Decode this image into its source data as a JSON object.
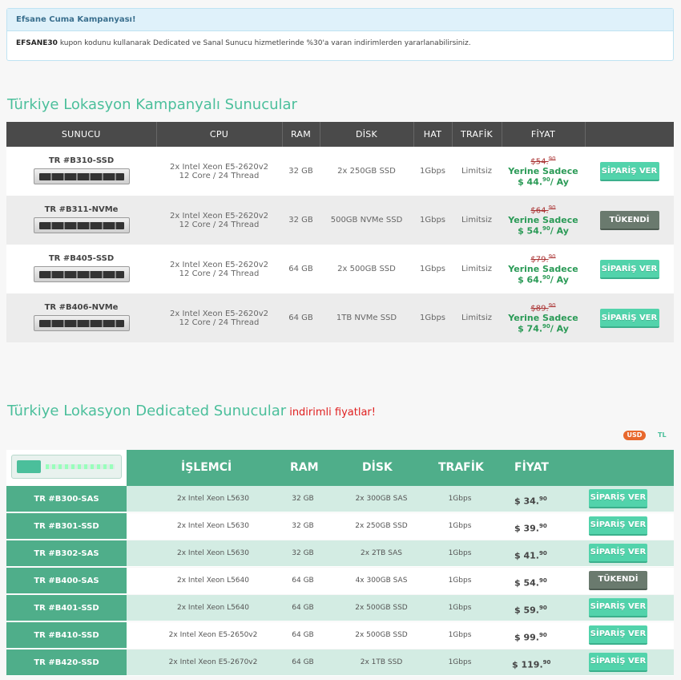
{
  "notice": {
    "title": "Efsane Cuma Kampanyası!",
    "coupon": "EFSANE30",
    "text": " kupon kodunu kullanarak Dedicated ve Sanal Sunucu hizmetlerinde %30'a varan indirimlerden yararlanabilirsiniz."
  },
  "campaign": {
    "title": "Türkiye Lokasyon Kampanyalı Sunucular",
    "headers": [
      "SUNUCU",
      "CPU",
      "RAM",
      "DİSK",
      "HAT",
      "TRAFİK",
      "FİYAT",
      ""
    ],
    "sadece_label": "Yerine Sadece",
    "per_month": "/ Ay",
    "rows": [
      {
        "name": "TR #B310-SSD",
        "cpu1": "2x Intel Xeon E5-2620v2",
        "cpu2": "12 Core / 24 Thread",
        "ram": "32 GB",
        "disk": "2x 250GB SSD",
        "hat": "1Gbps",
        "traffic": "Limitsiz",
        "old_int": "$54.",
        "old_dec": "90",
        "new_int": "$ 44.",
        "new_dec": "90",
        "button": "SİPARİŞ VER"
      },
      {
        "name": "TR #B311-NVMe",
        "cpu1": "2x Intel Xeon E5-2620v2",
        "cpu2": "12 Core / 24 Thread",
        "ram": "32 GB",
        "disk": "500GB NVMe SSD",
        "hat": "1Gbps",
        "traffic": "Limitsiz",
        "old_int": "$64.",
        "old_dec": "90",
        "new_int": "$ 54.",
        "new_dec": "90",
        "button": "TÜKENDİ"
      },
      {
        "name": "TR #B405-SSD",
        "cpu1": "2x Intel Xeon E5-2620v2",
        "cpu2": "12 Core / 24 Thread",
        "ram": "64 GB",
        "disk": "2x 500GB SSD",
        "hat": "1Gbps",
        "traffic": "Limitsiz",
        "old_int": "$79.",
        "old_dec": "90",
        "new_int": "$ 64.",
        "new_dec": "90",
        "button": "SİPARİŞ VER"
      },
      {
        "name": "TR #B406-NVMe",
        "cpu1": "2x Intel Xeon E5-2620v2",
        "cpu2": "12 Core / 24 Thread",
        "ram": "64 GB",
        "disk": "1TB NVMe SSD",
        "hat": "1Gbps",
        "traffic": "Limitsiz",
        "old_int": "$89.",
        "old_dec": "90",
        "new_int": "$ 74.",
        "new_dec": "90",
        "button": "SİPARİŞ VER"
      }
    ]
  },
  "dedicated": {
    "title": "Türkiye Lokasyon Dedicated Sunucular",
    "tag": "indirimli fiyatlar!",
    "currency_usd": "USD",
    "currency_tl": "TL",
    "headers": [
      "İŞLEMCİ",
      "RAM",
      "DİSK",
      "TRAFİK",
      "FİYAT"
    ],
    "rows": [
      {
        "name": "TR #B300-SAS",
        "cpu": "2x Intel Xeon L5630",
        "ram": "32 GB",
        "disk": "2x 300GB SAS",
        "traffic": "1Gbps",
        "price_int": "$ 34.",
        "price_dec": "90",
        "button": "SİPARİŞ VER"
      },
      {
        "name": "TR #B301-SSD",
        "cpu": "2x Intel Xeon L5630",
        "ram": "32 GB",
        "disk": "2x 250GB SSD",
        "traffic": "1Gbps",
        "price_int": "$ 39.",
        "price_dec": "90",
        "button": "SİPARİŞ VER"
      },
      {
        "name": "TR #B302-SAS",
        "cpu": "2x Intel Xeon L5630",
        "ram": "32 GB",
        "disk": "2x 2TB SAS",
        "traffic": "1Gbps",
        "price_int": "$ 41.",
        "price_dec": "90",
        "button": "SİPARİŞ VER"
      },
      {
        "name": "TR #B400-SAS",
        "cpu": "2x Intel Xeon L5640",
        "ram": "64 GB",
        "disk": "4x 300GB SAS",
        "traffic": "1Gbps",
        "price_int": "$ 54.",
        "price_dec": "90",
        "button": "TÜKENDİ"
      },
      {
        "name": "TR #B401-SSD",
        "cpu": "2x Intel Xeon L5640",
        "ram": "64 GB",
        "disk": "2x 500GB SSD",
        "traffic": "1Gbps",
        "price_int": "$ 59.",
        "price_dec": "90",
        "button": "SİPARİŞ VER"
      },
      {
        "name": "TR #B410-SSD",
        "cpu": "2x Intel Xeon E5-2650v2",
        "ram": "64 GB",
        "disk": "2x 500GB SSD",
        "traffic": "1Gbps",
        "price_int": "$ 99.",
        "price_dec": "90",
        "button": "SİPARİŞ VER"
      },
      {
        "name": "TR #B420-SSD",
        "cpu": "2x Intel Xeon E5-2670v2",
        "ram": "64 GB",
        "disk": "2x 1TB SSD",
        "traffic": "1Gbps",
        "price_int": "$ 119.",
        "price_dec": "90",
        "button": "SİPARİŞ VER"
      }
    ]
  },
  "colors": {
    "accent": "#4bbf9b",
    "header_dark": "#4a4a4a",
    "order_button": "#52d3ab",
    "soldout_button": "#6a7a6e",
    "usd_badge": "#e8682d"
  }
}
